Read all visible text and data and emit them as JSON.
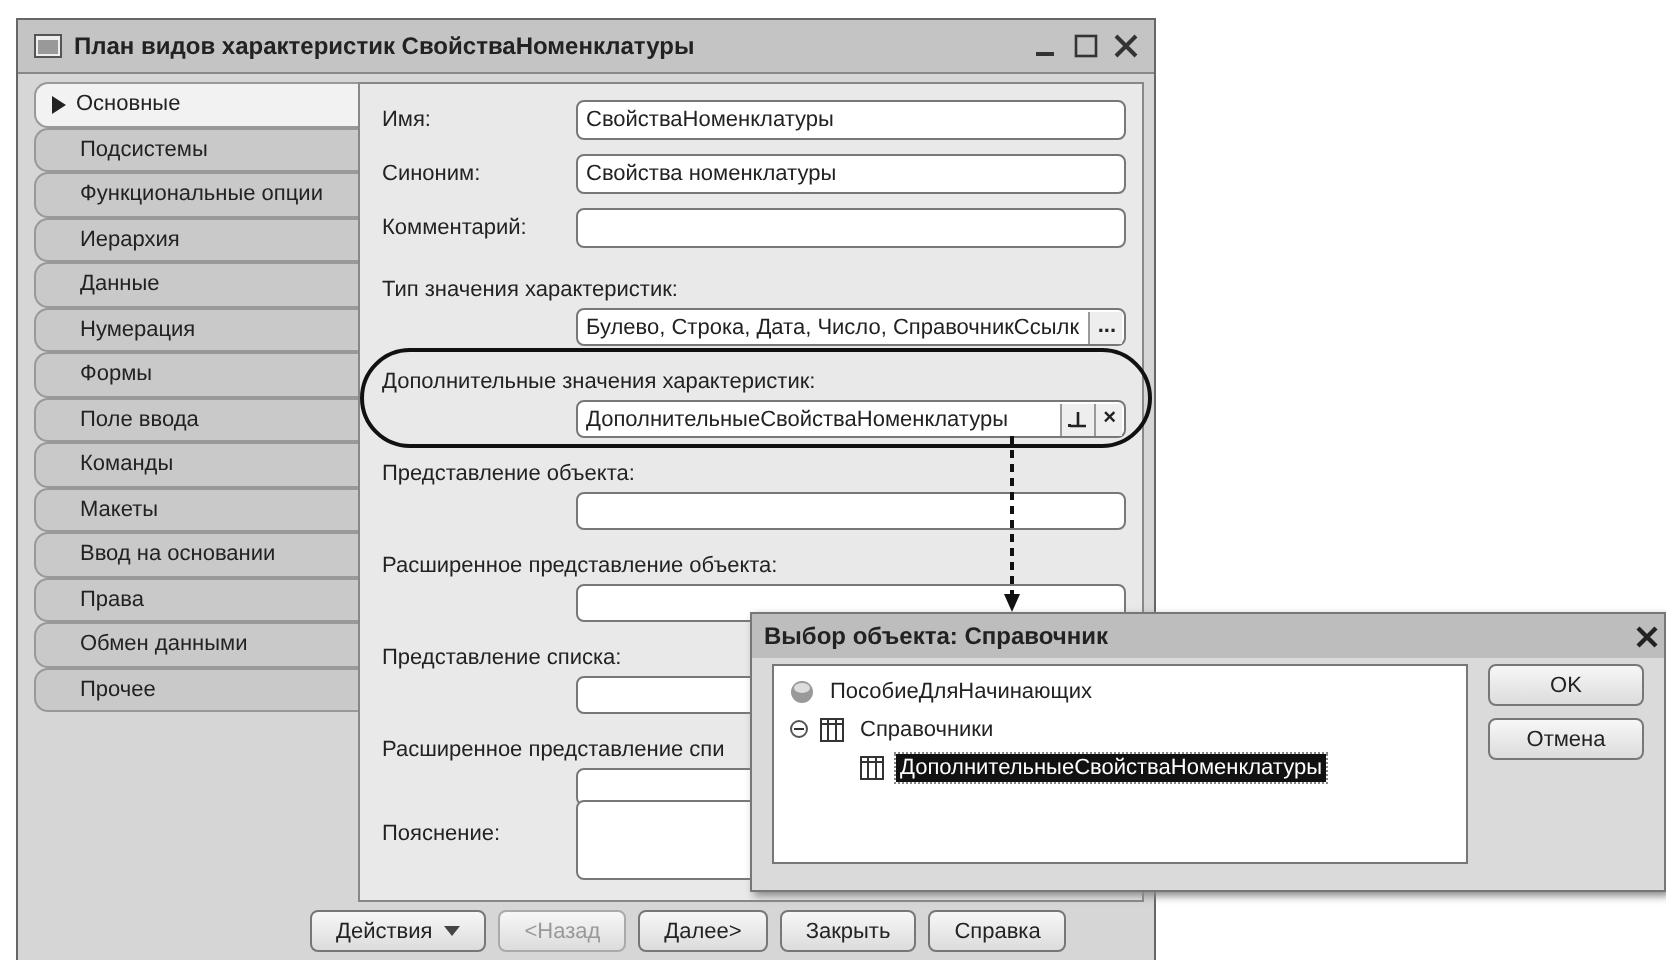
{
  "window": {
    "title": "План видов характеристик СвойстваНоменклатуры"
  },
  "tabs": [
    {
      "label": "Основные",
      "selected": true
    },
    {
      "label": "Подсистемы",
      "selected": false
    },
    {
      "label": "Функциональные опции",
      "selected": false
    },
    {
      "label": "Иерархия",
      "selected": false
    },
    {
      "label": "Данные",
      "selected": false
    },
    {
      "label": "Нумерация",
      "selected": false
    },
    {
      "label": "Формы",
      "selected": false
    },
    {
      "label": "Поле ввода",
      "selected": false
    },
    {
      "label": "Команды",
      "selected": false
    },
    {
      "label": "Макеты",
      "selected": false
    },
    {
      "label": "Ввод на основании",
      "selected": false
    },
    {
      "label": "Права",
      "selected": false
    },
    {
      "label": "Обмен данными",
      "selected": false
    },
    {
      "label": "Прочее",
      "selected": false
    }
  ],
  "fields": [
    {
      "kind": "inline",
      "label": "Имя:",
      "value": "СвойстваНоменклатуры"
    },
    {
      "kind": "inline",
      "label": "Синоним:",
      "value": "Свойства номенклатуры"
    },
    {
      "kind": "inline",
      "label": "Комментарий:"
    },
    {
      "kind": "stacked",
      "label": "Тип значения характеристик:",
      "value": "Булево, Строка, Дата, Число, СправочникСсылк",
      "actions": [
        {
          "kind": "text",
          "text": "..."
        }
      ]
    },
    {
      "kind": "stacked",
      "label": "Дополнительные значения характеристик:",
      "value": "ДополнительныеСвойстваНоменклатуры",
      "actions": [
        {
          "kind": "select"
        },
        {
          "kind": "text",
          "text": "×"
        }
      ]
    },
    {
      "kind": "stacked",
      "label": "Представление объекта:"
    },
    {
      "kind": "stacked",
      "label": "Расширенное представление объекта:"
    },
    {
      "kind": "stacked",
      "label": "Представление списка:"
    },
    {
      "kind": "stacked",
      "label": "Расширенное представление спи"
    },
    {
      "kind": "textarea",
      "label": "Пояснение:"
    }
  ],
  "buttons": [
    {
      "label": "Действия",
      "dropdown": true,
      "disabled": false
    },
    {
      "label": "<Назад",
      "dropdown": false,
      "disabled": true
    },
    {
      "label": "Далее>",
      "dropdown": false,
      "disabled": false
    },
    {
      "label": "Закрыть",
      "dropdown": false,
      "disabled": false
    },
    {
      "label": "Справка",
      "dropdown": false,
      "disabled": false
    }
  ],
  "dialog": {
    "title": "Выбор объекта: Справочник",
    "tree": [
      {
        "kind": "config",
        "label": "ПособиеДляНачинающих",
        "selected": false
      },
      {
        "kind": "group",
        "label": "Справочники",
        "selected": false,
        "expanded": true,
        "children": [
          {
            "kind": "catalog",
            "label": "ДополнительныеСвойстваНоменклатуры",
            "selected": true
          }
        ]
      }
    ],
    "buttons": [
      "OK",
      "Отмена"
    ]
  }
}
